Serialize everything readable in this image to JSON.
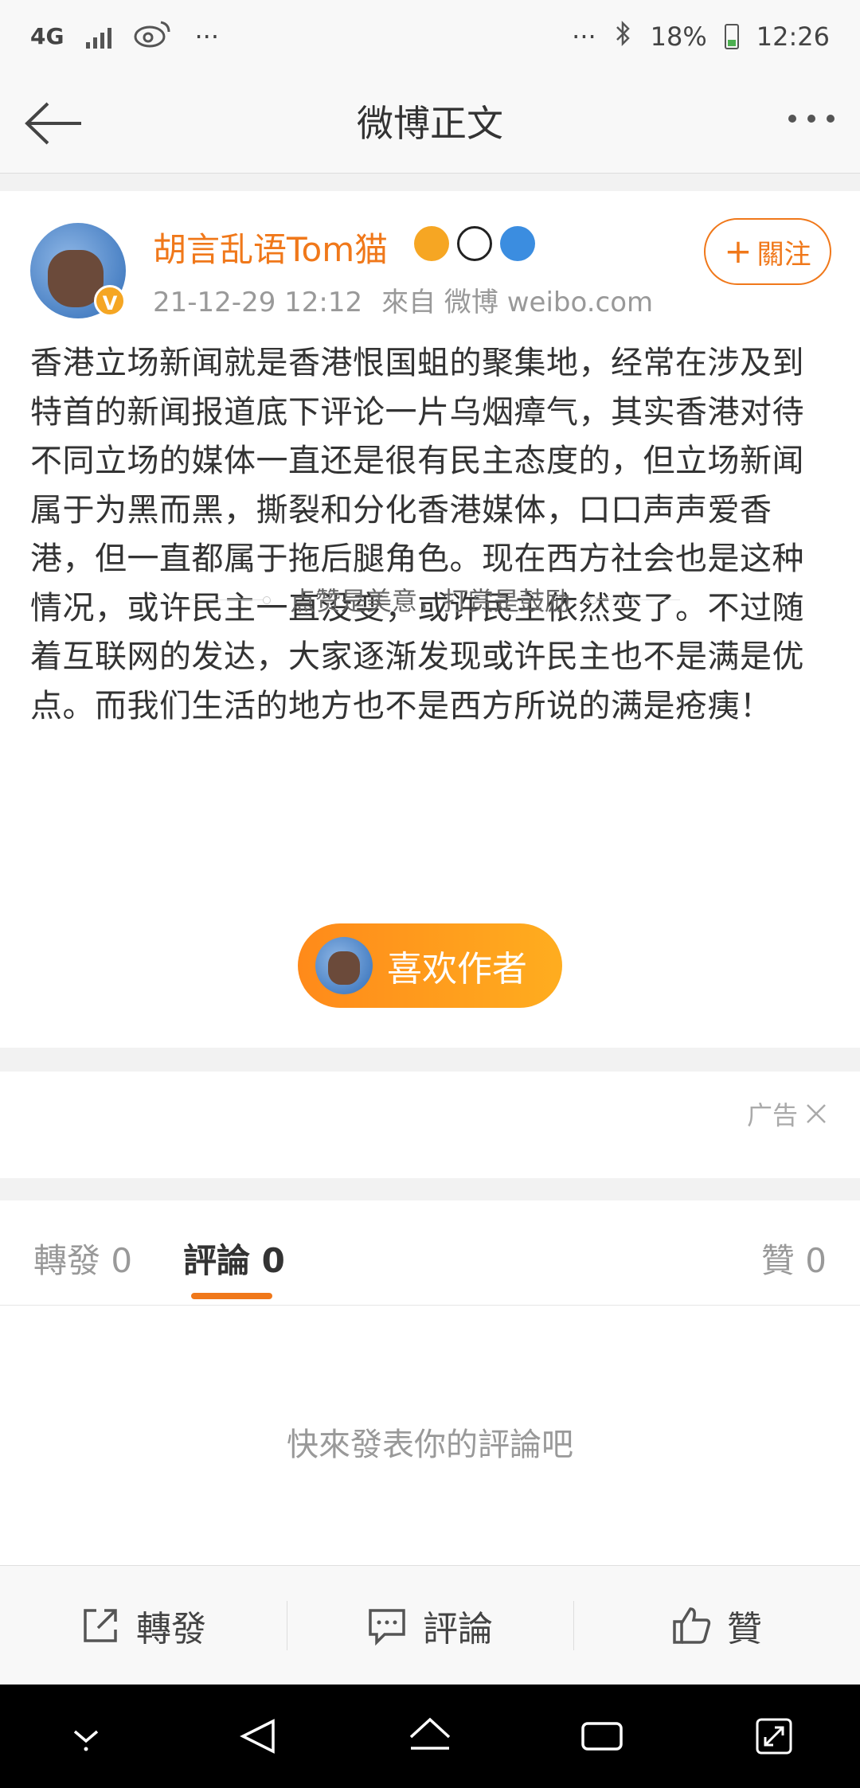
{
  "status_bar": {
    "network": "4G",
    "more": "···",
    "more_right": "···",
    "battery": "18%",
    "time": "12:26"
  },
  "nav": {
    "title": "微博正文"
  },
  "post": {
    "user_name": "胡言乱语Tom猫",
    "verify_label": "V",
    "timestamp": "21-12-29 12:12",
    "source": "來自 微博 weibo.com",
    "follow_label": "關注",
    "follow_plus": "+",
    "body": "香港立场新闻就是香港恨国蛆的聚集地，经常在涉及到特首的新闻报道底下评论一片乌烟瘴气，其实香港对待不同立场的媒体一直还是很有民主态度的，但立场新闻属于为黑而黑，撕裂和分化香港媒体，口口声声爱香港，但一直都属于拖后腿角色。现在西方社会也是这种情况，或许民主一直没变，或许民主依然变了。不过随着互联网的发达，大家逐渐发现或许民主也不是满是优点。而我们生活的地方也不是西方所说的满是疮痍！",
    "reward_hint": "点赞是美意，打赏是鼓励",
    "like_author_label": "喜欢作者"
  },
  "ad": {
    "label": "广告"
  },
  "tabs": {
    "repost": "轉發 0",
    "comment": "評論 0",
    "like": "贊 0"
  },
  "comments": {
    "empty_text": "快來發表你的評論吧"
  },
  "toolbar": {
    "repost_label": "轉發",
    "comment_label": "評論",
    "like_label": "贊"
  },
  "colors": {
    "accent": "#f0781a",
    "button_gradient_start": "#ff8a1a",
    "button_gradient_end": "#ffad1f"
  }
}
